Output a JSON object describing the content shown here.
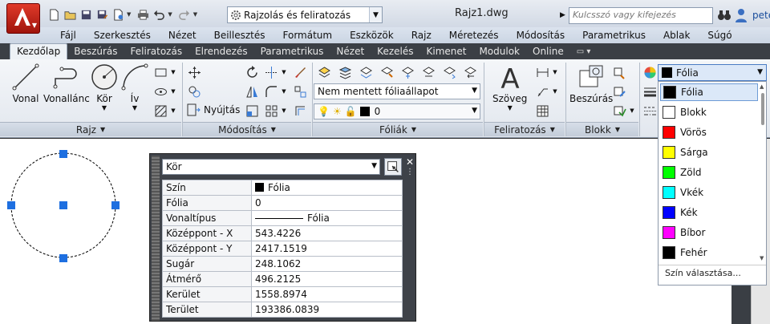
{
  "title_bar": {
    "workspace": "Rajzolás és feliratozás",
    "document": "Rajz1.dwg",
    "search_placeholder": "Kulcsszó vagy kifejezés",
    "user": "pete"
  },
  "menu": [
    "Fájl",
    "Szerkesztés",
    "Nézet",
    "Beillesztés",
    "Formátum",
    "Eszközök",
    "Rajz",
    "Méretezés",
    "Módosítás",
    "Parametrikus",
    "Ablak",
    "Súgó"
  ],
  "ribbon_tabs": [
    "Kezdőlap",
    "Beszúrás",
    "Feliratozás",
    "Elrendezés",
    "Parametrikus",
    "Nézet",
    "Kezelés",
    "Kimenet",
    "Modulok",
    "Online"
  ],
  "active_tab": "Kezdőlap",
  "panels": {
    "draw": {
      "title": "Rajz",
      "tools": [
        "Vonal",
        "Vonallánc",
        "Kör",
        "Ív"
      ]
    },
    "modify": {
      "title": "Módosítás",
      "stretch_label": "Nyújtás"
    },
    "layers": {
      "title": "Fóliák",
      "layer_state": "Nem mentett fóliaállapot",
      "current_layer": "0"
    },
    "annotation": {
      "title": "Feliratozás",
      "text_tool": "Szöveg"
    },
    "block": {
      "title": "Blokk",
      "insert_tool": "Beszúrás"
    }
  },
  "color_dropdown": {
    "selected": "Fólia",
    "items": [
      {
        "label": "Fólia",
        "color": "#000000"
      },
      {
        "label": "Blokk",
        "color": "#ffffff"
      },
      {
        "label": "Vörös",
        "color": "#ff0000"
      },
      {
        "label": "Sárga",
        "color": "#ffff00"
      },
      {
        "label": "Zöld",
        "color": "#00ff00"
      },
      {
        "label": "Vkék",
        "color": "#00ffff"
      },
      {
        "label": "Kék",
        "color": "#0000ff"
      },
      {
        "label": "Bíbor",
        "color": "#ff00ff"
      },
      {
        "label": "Fehér",
        "color": "#000000"
      }
    ],
    "more": "Szín választása..."
  },
  "properties": {
    "object_type": "Kör",
    "rows": [
      {
        "key": "Szín",
        "value": "Fólia"
      },
      {
        "key": "Fólia",
        "value": "0"
      },
      {
        "key": "Vonaltípus",
        "value": "Fólia"
      },
      {
        "key": "Középpont - X",
        "value": "543.4226"
      },
      {
        "key": "Középpont - Y",
        "value": "2417.1519"
      },
      {
        "key": "Sugár",
        "value": "248.1062"
      },
      {
        "key": "Átmérő",
        "value": "496.2125"
      },
      {
        "key": "Kerület",
        "value": "1558.8974"
      },
      {
        "key": "Terület",
        "value": "193386.0839"
      }
    ]
  },
  "colors": {
    "accent": "#4a7cc4",
    "grip": "#1e6fe0",
    "app_button": "#c8261a"
  }
}
